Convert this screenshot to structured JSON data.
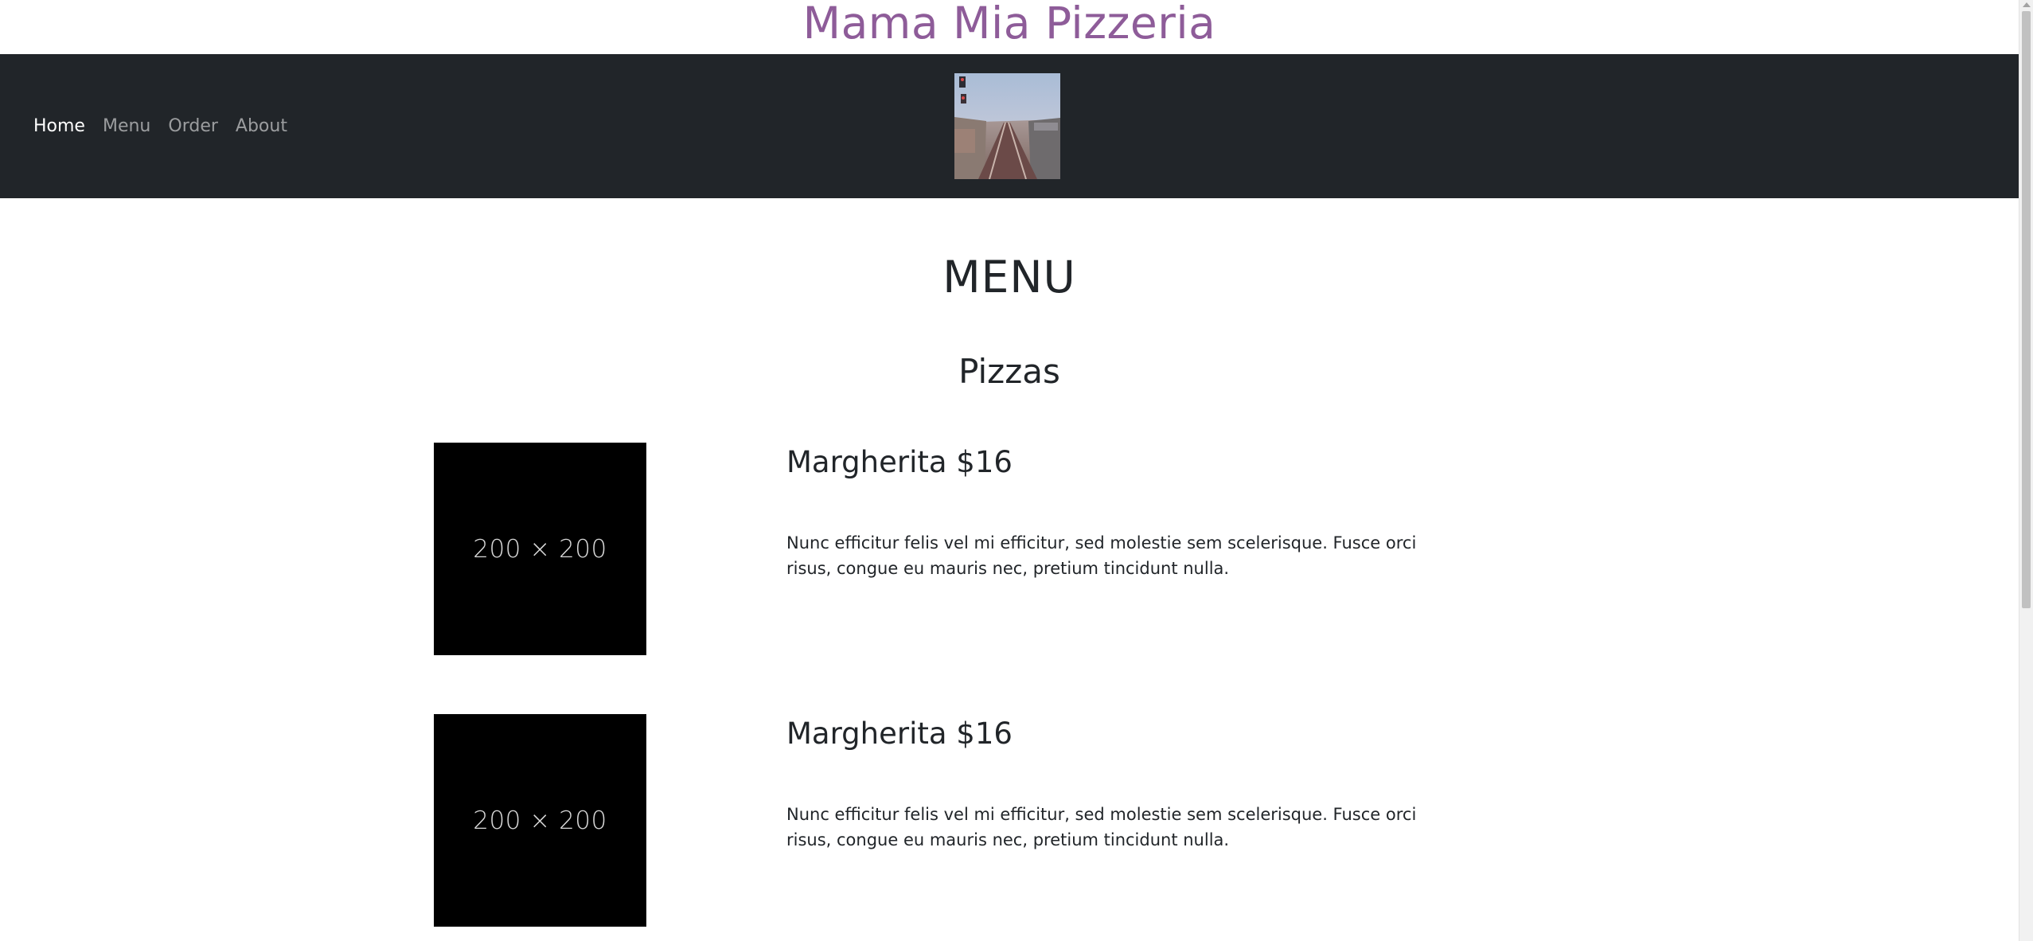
{
  "header": {
    "site_title": "Mama Mia Pizzeria"
  },
  "nav": {
    "items": [
      {
        "label": "Home",
        "active": true
      },
      {
        "label": "Menu",
        "active": false
      },
      {
        "label": "Order",
        "active": false
      },
      {
        "label": "About",
        "active": false
      }
    ]
  },
  "main": {
    "menu_heading": "MENU",
    "section_heading": "Pizzas",
    "items": [
      {
        "image_label": "200 × 200",
        "title": "Margherita $16",
        "description": "Nunc efficitur felis vel mi efficitur, sed molestie sem scelerisque. Fusce orci risus, congue eu mauris nec, pretium tincidunt nulla."
      },
      {
        "image_label": "200 × 200",
        "title": "Margherita $16",
        "description": "Nunc efficitur felis vel mi efficitur, sed molestie sem scelerisque. Fusce orci risus, congue eu mauris nec, pretium tincidunt nulla."
      }
    ]
  },
  "colors": {
    "title": "#8e5c99",
    "navbar_bg": "#212529",
    "text": "#212529",
    "placeholder_bg": "#000000"
  }
}
